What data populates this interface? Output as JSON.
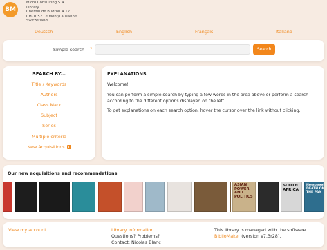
{
  "header": {
    "logo_text": "BM",
    "address_lines": [
      "Micro Consulting S.A.",
      "Library",
      "Chemin de Budron A 12",
      "CH-1052 Le Mont/Lausanne",
      "Switzerland"
    ]
  },
  "languages": [
    "Deutsch",
    "English",
    "Français",
    "Italiano"
  ],
  "search": {
    "label": "Simple search",
    "help": "?",
    "input_value": "",
    "button": "Search"
  },
  "search_by": {
    "title": "SEARCH BY...",
    "items": [
      "Title / Keywords",
      "Authors",
      "Class Mark",
      "Subject",
      "Series",
      "Multiple criteria",
      "New Acquisitions"
    ],
    "rss_icon": "rss-icon"
  },
  "explanations": {
    "title": "EXPLANATIONS",
    "paragraphs": [
      "Welcome!",
      "You can perform a simple search by typing a few words in the area above or perform a search according to the different options displayed on the left.",
      "To get explanations on each search option, hover the cursor over the link without clicking."
    ]
  },
  "acquisitions": {
    "title": "Our new acquisitions and recommendations",
    "covers": [
      {
        "color": "#c8382e",
        "text": ""
      },
      {
        "color": "#1d1d1d",
        "text": ""
      },
      {
        "color": "#1a1a1a",
        "text": ""
      },
      {
        "color": "#2a8d9a",
        "text": ""
      },
      {
        "color": "#c4502a",
        "text": ""
      },
      {
        "color": "#f2d1cc",
        "text": ""
      },
      {
        "color": "#9fb9c9",
        "text": ""
      },
      {
        "color": "#e8e3df",
        "text": ""
      },
      {
        "color": "#7a5b3a",
        "text": ""
      },
      {
        "color": "#8a6a44",
        "text": ""
      },
      {
        "color": "#c9b28a",
        "text": "ASIAN POWER AND POLITICS"
      },
      {
        "color": "#2b2b2b",
        "text": ""
      },
      {
        "color": "#d7d7d7",
        "text": "SOUTH AFRICA"
      },
      {
        "color": "#2e6e8e",
        "text": "Newsweek DEATH ON THE PAN"
      }
    ]
  },
  "footer": {
    "view_account": "View my account",
    "library_info": "Library Information",
    "questions": "Questions? Problems?",
    "contact": "Contact: Nicolas Blanc",
    "managed_text": "This library is managed with the software",
    "software_link": "BiblioMaker",
    "version": "(version v7.3r28)."
  }
}
